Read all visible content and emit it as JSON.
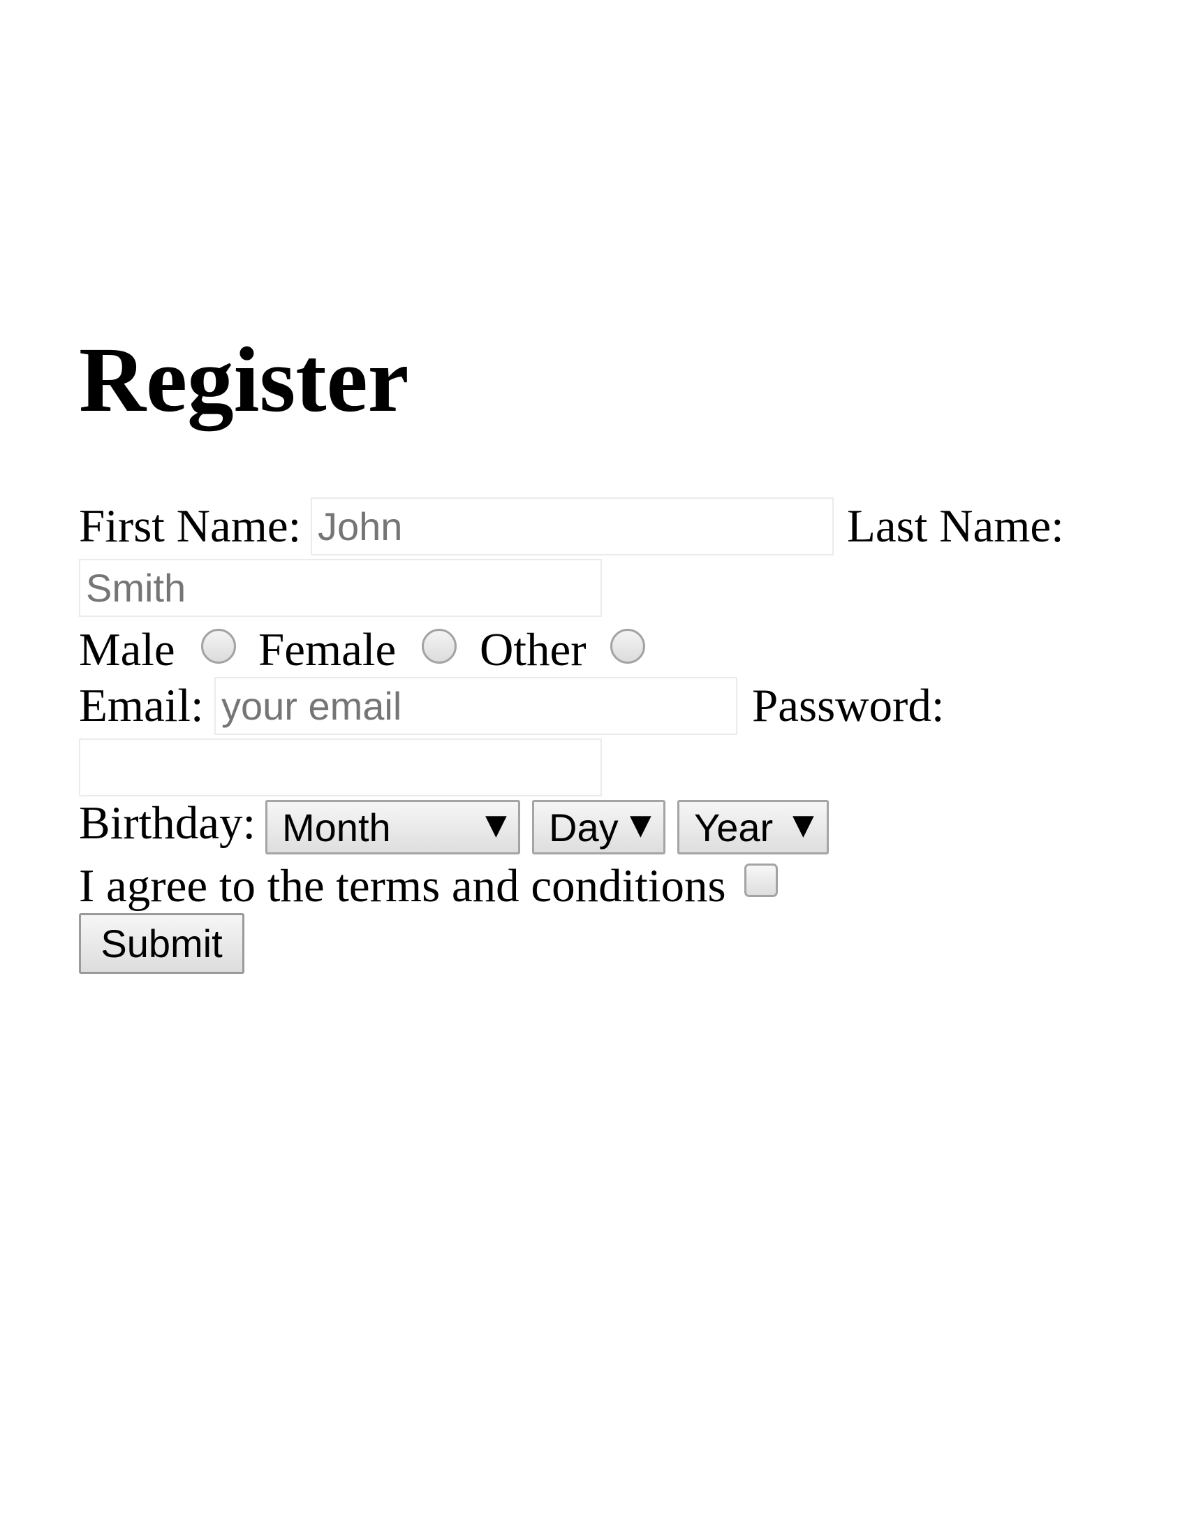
{
  "title": "Register",
  "form": {
    "first_name": {
      "label": "First Name:",
      "placeholder": "John",
      "value": ""
    },
    "last_name": {
      "label": "Last Name:",
      "placeholder": "Smith",
      "value": ""
    },
    "gender": {
      "options": [
        {
          "label": "Male",
          "checked": false
        },
        {
          "label": "Female",
          "checked": false
        },
        {
          "label": "Other",
          "checked": false
        }
      ]
    },
    "email": {
      "label": "Email:",
      "placeholder": "your email",
      "value": ""
    },
    "password": {
      "label": "Password:",
      "placeholder": "",
      "value": ""
    },
    "birthday": {
      "label": "Birthday:",
      "month": "Month",
      "day": "Day",
      "year": "Year",
      "arrow_glyph": "▼"
    },
    "terms": {
      "label": "I agree to the terms and conditions",
      "checked": false
    },
    "submit_label": "Submit"
  },
  "colors": {
    "field_border": "#ebebeb",
    "placeholder": "#757575",
    "control_border": "#a3a3a3"
  }
}
